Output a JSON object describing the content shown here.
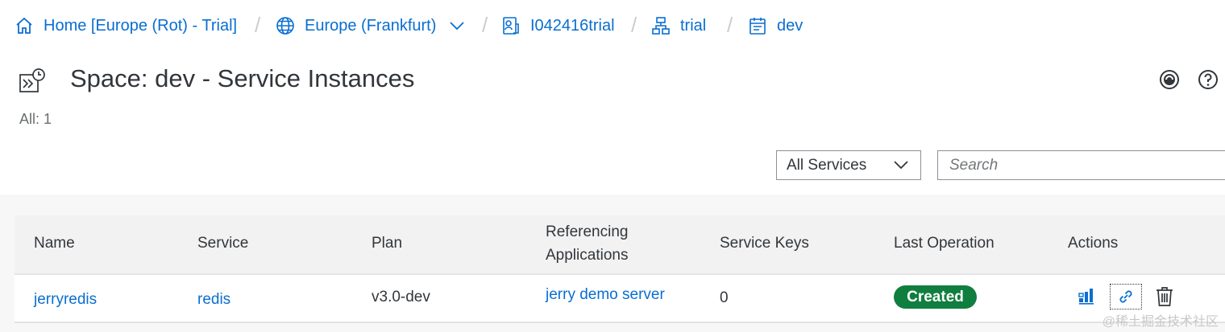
{
  "breadcrumb": {
    "home": "Home [Europe (Rot) - Trial]",
    "region": "Europe (Frankfurt)",
    "subaccount": "I042416trial",
    "org": "trial",
    "space": "dev",
    "separator": "/"
  },
  "page": {
    "title": "Space: dev - Service Instances",
    "count": "All: 1"
  },
  "filter": {
    "selected": "All Services",
    "search_placeholder": "Search"
  },
  "table": {
    "headers": {
      "name": "Name",
      "service": "Service",
      "plan": "Plan",
      "referencing_line1": "Referencing",
      "referencing_line2": "Applications",
      "service_keys": "Service Keys",
      "last_operation": "Last Operation",
      "actions": "Actions"
    },
    "rows": [
      {
        "name": "jerryredis",
        "service": "redis",
        "plan": "v3.0-dev",
        "referencing": "jerry demo server",
        "service_keys": "0",
        "last_operation": "Created"
      }
    ]
  },
  "colors": {
    "link": "#0a6ed1",
    "status_success": "#107e3e",
    "text": "#32363a"
  },
  "icons": {
    "home": "home-icon",
    "region": "globe-icon",
    "subaccount": "account-icon",
    "org": "hierarchy-icon",
    "space": "space-icon",
    "page": "service-instances-icon",
    "header_left": "sap-logo-icon",
    "header_right": "help-icon"
  },
  "watermark": "@稀土掘金技术社区"
}
